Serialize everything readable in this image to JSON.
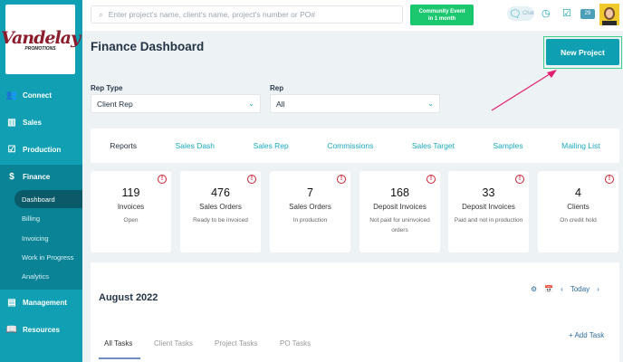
{
  "sidebar": {
    "logo": {
      "name": "Vandelay",
      "sub": "PROMOTIONS"
    },
    "items": [
      {
        "label": "Connect"
      },
      {
        "label": "Sales"
      },
      {
        "label": "Production"
      },
      {
        "label": "Finance"
      },
      {
        "label": "Management"
      },
      {
        "label": "Resources"
      }
    ],
    "finance_sub": [
      "Dashboard",
      "Billing",
      "Invoicing",
      "Work in Progress",
      "Analytics"
    ]
  },
  "header": {
    "search_placeholder": "Enter project's name, client's name, project's number or PO#",
    "event_line1": "Community Event",
    "event_line2": "in 1 month",
    "chat": "Chat",
    "badge": "29"
  },
  "page": {
    "title": "Finance Dashboard",
    "new_project": "New Project",
    "rep_type_label": "Rep Type",
    "rep_type_value": "Client Rep",
    "rep_label": "Rep",
    "rep_value": "All",
    "tabs": [
      "Reports",
      "Sales Dash",
      "Sales Rep",
      "Commissions",
      "Sales Target",
      "Samples",
      "Mailing List"
    ],
    "cards": [
      {
        "num": "119",
        "title": "Invoices",
        "sub": "Open"
      },
      {
        "num": "476",
        "title": "Sales Orders",
        "sub": "Ready to be invoiced"
      },
      {
        "num": "7",
        "title": "Sales Orders",
        "sub": "In production"
      },
      {
        "num": "168",
        "title": "Deposit Invoices",
        "sub": "Not paid for uninvoiced orders"
      },
      {
        "num": "33",
        "title": "Deposit Invoices",
        "sub": "Paid and not in production"
      },
      {
        "num": "4",
        "title": "Clients",
        "sub": "On credit hold"
      }
    ],
    "calendar": {
      "month": "August 2022",
      "today": "Today",
      "add_task": "+ Add Task",
      "task_tabs": [
        "All Tasks",
        "Client Tasks",
        "Project Tasks",
        "PO Tasks"
      ]
    }
  },
  "colors": {
    "accent": "#0e9fb3",
    "event": "#1cc86f",
    "alert": "#cc2233",
    "arrow": "#e0206f"
  }
}
